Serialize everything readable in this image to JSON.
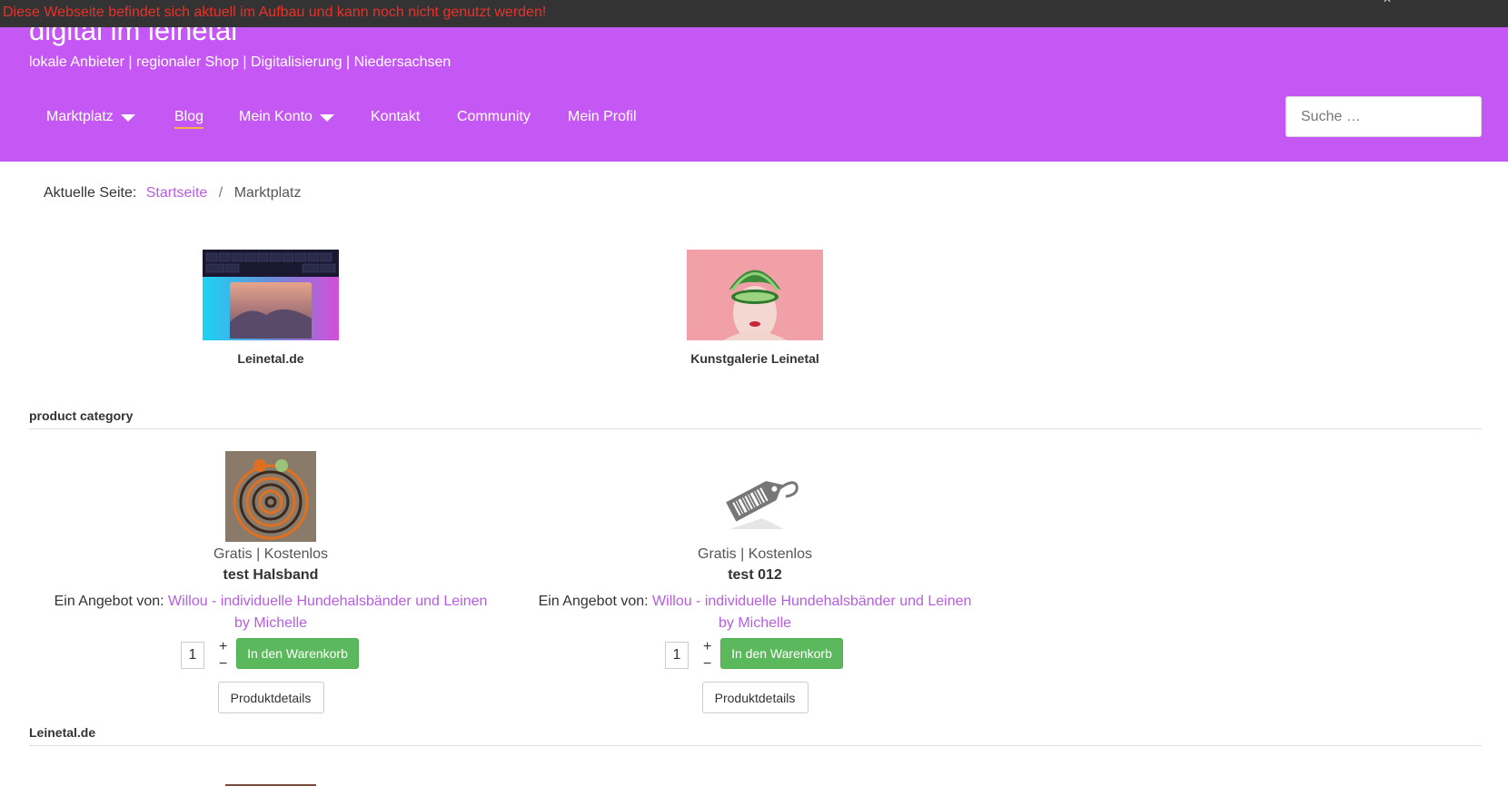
{
  "notice": {
    "text": "Diese Webseite befindet sich aktuell im Aufbau und kann noch nicht genutzt werden!"
  },
  "header": {
    "site_title": "digital im leinetal",
    "tagline": "lokale Anbieter | regionaler Shop | Digitalisierung | Niedersachsen",
    "brand_color": "#c558f4"
  },
  "nav": {
    "items": [
      {
        "label": "Marktplatz",
        "dropdown": true
      },
      {
        "label": "Blog",
        "active": true
      },
      {
        "label": "Mein Konto",
        "dropdown": true
      },
      {
        "label": "Kontakt"
      },
      {
        "label": "Community"
      },
      {
        "label": "Mein Profil"
      }
    ],
    "search_placeholder": "Suche …"
  },
  "breadcrumb": {
    "prefix": "Aktuelle Seite:",
    "items": [
      "Startseite",
      "Marktplatz"
    ]
  },
  "vendors": [
    {
      "name": "Leinetal.de",
      "image": "keyboard-gradient-image"
    },
    {
      "name": "Kunstgalerie Leinetal",
      "image": "portrait-image"
    }
  ],
  "sections": {
    "product_category": "product category",
    "leinetal": "Leinetal.de"
  },
  "products": [
    {
      "price": "Gratis | Kostenlos",
      "name": "test Halsband",
      "offer_prefix": "Ein Angebot von:",
      "vendor": "Willou - individuelle Hundehalsbänder und Leinen",
      "vendor_suffix": "by Michelle",
      "qty": "1",
      "add_to_cart": "In den Warenkorb",
      "details": "Produktdetails",
      "image": "dog-collar-image"
    },
    {
      "price": "Gratis | Kostenlos",
      "name": "test 012",
      "offer_prefix": "Ein Angebot von:",
      "vendor": "Willou - individuelle Hundehalsbänder und Leinen",
      "vendor_suffix": "by Michelle",
      "qty": "1",
      "add_to_cart": "In den Warenkorb",
      "details": "Produktdetails",
      "image": "price-tag-placeholder-icon"
    }
  ],
  "qty_controls": {
    "plus": "+",
    "minus": "−"
  },
  "colors": {
    "link": "#b65de0",
    "button_green": "#5cb85c",
    "notice_red": "#e8312b",
    "nav_active_underline": "#f5b342"
  }
}
